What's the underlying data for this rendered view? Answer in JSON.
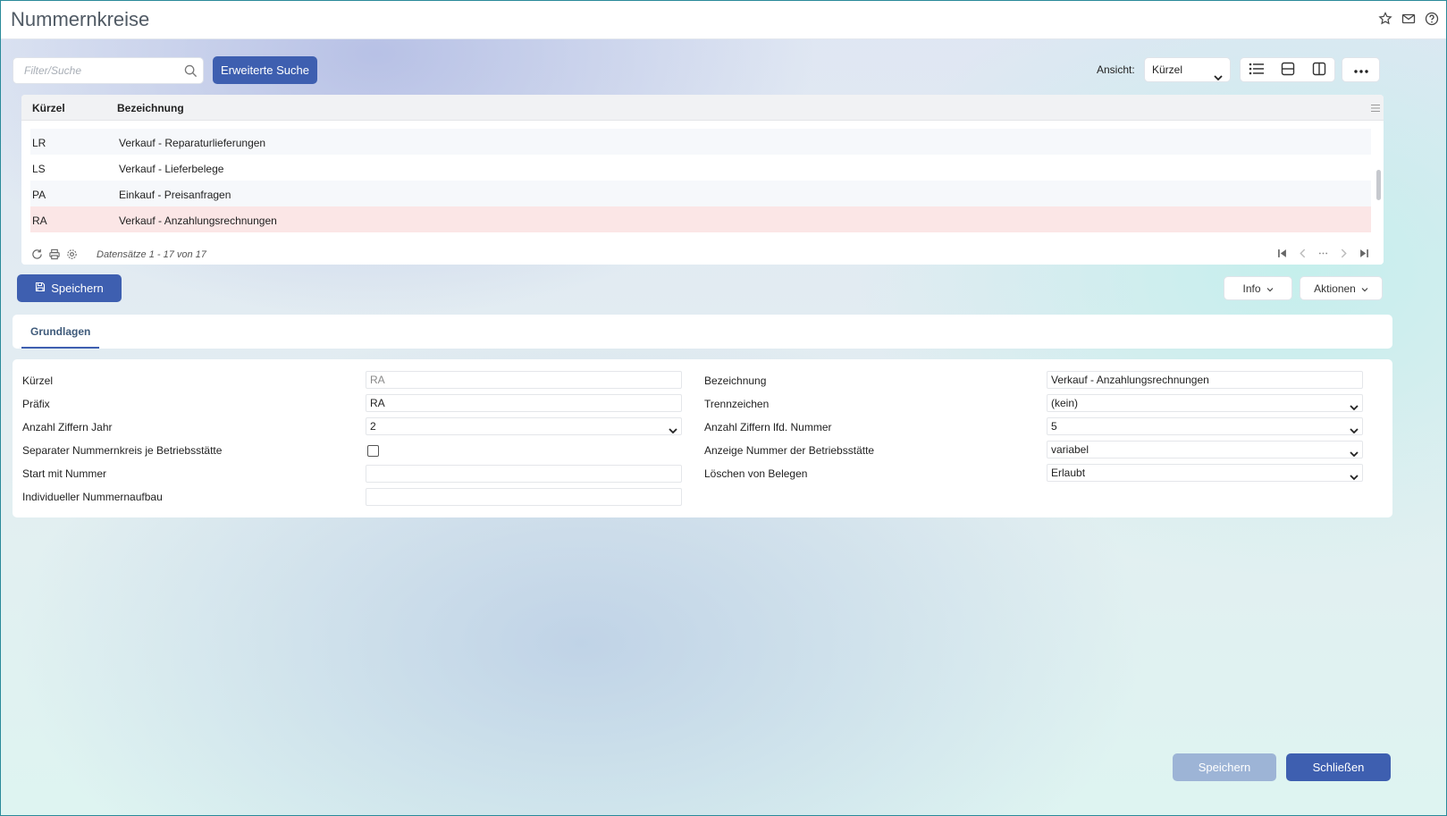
{
  "window": {
    "title": "Nummernkreise"
  },
  "toolbar": {
    "search_placeholder": "Filter/Suche",
    "extended_search_label": "Erweiterte Suche",
    "view_label": "Ansicht:",
    "view_value": "Kürzel"
  },
  "grid": {
    "columns": [
      "Kürzel",
      "Bezeichnung"
    ],
    "rows": [
      {
        "kuerzel": "LR",
        "bezeichnung": "Verkauf - Reparaturlieferungen"
      },
      {
        "kuerzel": "LS",
        "bezeichnung": "Verkauf - Lieferbelege"
      },
      {
        "kuerzel": "PA",
        "bezeichnung": "Einkauf - Preisanfragen"
      },
      {
        "kuerzel": "RA",
        "bezeichnung": "Verkauf - Anzahlungsrechnungen"
      }
    ],
    "selected_row": "RA",
    "record_count": "Datensätze 1 - 17 von 17"
  },
  "actions": {
    "save_label": "Speichern",
    "info_label": "Info",
    "actions_label": "Aktionen"
  },
  "tabs": [
    {
      "label": "Grundlagen",
      "active": true
    }
  ],
  "form": {
    "kuerzel": {
      "label": "Kürzel",
      "value": "RA"
    },
    "praefix": {
      "label": "Präfix",
      "value": "RA"
    },
    "anzahl_ziffern_jahr": {
      "label": "Anzahl Ziffern Jahr",
      "value": "2"
    },
    "separater_nummernkreis": {
      "label": "Separater Nummernkreis je Betriebsstätte",
      "checked": false
    },
    "start_mit_nummer": {
      "label": "Start mit Nummer",
      "value": ""
    },
    "individueller_aufbau": {
      "label": "Individueller Nummernaufbau",
      "value": ""
    },
    "bezeichnung": {
      "label": "Bezeichnung",
      "value": "Verkauf - Anzahlungsrechnungen"
    },
    "trennzeichen": {
      "label": "Trennzeichen",
      "value": "(kein)"
    },
    "anzahl_ziffern_lfd": {
      "label": "Anzahl Ziffern lfd. Nummer",
      "value": "5"
    },
    "anzeige_nummer": {
      "label": "Anzeige Nummer der Betriebsstätte",
      "value": "variabel"
    },
    "loeschen": {
      "label": "Löschen von Belegen",
      "value": "Erlaubt"
    }
  },
  "footer": {
    "save_label": "Speichern",
    "close_label": "Schließen"
  },
  "colors": {
    "primary": "#3e5fb0",
    "disabled_primary": "#9db4d6",
    "selected_row": "#fbe6e6"
  }
}
